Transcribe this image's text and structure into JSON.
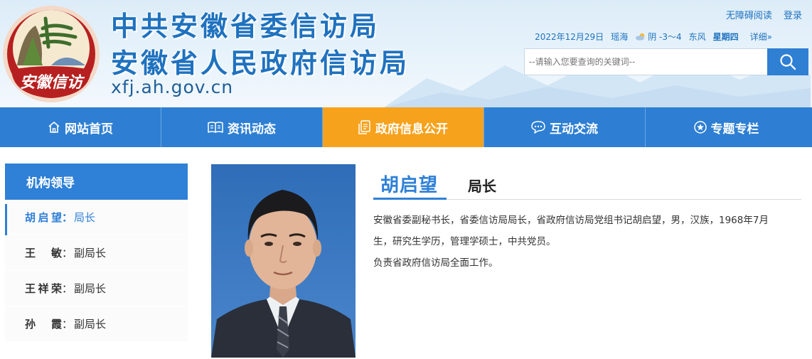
{
  "header": {
    "title_line1": "中共安徽省委信访局",
    "title_line2": "安徽省人民政府信访局",
    "domain": "xfj.ah.gov.cn",
    "emblem_text": "安徽信访",
    "links": {
      "accessibility": "无障碍阅读",
      "login": "登录"
    },
    "info": {
      "date": "2022年12月29日",
      "city": "瑶海",
      "weather": "阴 -3～4",
      "wind": "东风",
      "weekday": "星期四",
      "more": "详细»"
    },
    "search": {
      "placeholder": "--请输入您要查询的关键词--"
    }
  },
  "nav": {
    "items": [
      {
        "label": "网站首页",
        "icon": "home-icon"
      },
      {
        "label": "资讯动态",
        "icon": "book-icon"
      },
      {
        "label": "政府信息公开",
        "icon": "document-icon"
      },
      {
        "label": "互动交流",
        "icon": "chat-icon"
      },
      {
        "label": "专题专栏",
        "icon": "star-icon"
      }
    ],
    "active_index": 2
  },
  "sidebar": {
    "heading": "机构领导",
    "items": [
      {
        "name": "胡启望",
        "role": "局长"
      },
      {
        "name": "王敏",
        "role": "副局长"
      },
      {
        "name": "王祥荣",
        "role": "副局长"
      },
      {
        "name": "孙霞",
        "role": "副局长"
      }
    ],
    "active_index": 0
  },
  "detail": {
    "name": "胡启望",
    "title": "局长",
    "bio_line1": "安徽省委副秘书长，省委信访局局长，省政府信访局党组书记胡启望，男，汉族，1968年7月",
    "bio_line2": "生，研究生学历，管理学硕士，中共党员。",
    "duty": "负责省政府信访局全面工作。"
  },
  "colors": {
    "primary": "#2e7fd3",
    "accent": "#f7a21d",
    "title_blue": "#1f72bf"
  }
}
